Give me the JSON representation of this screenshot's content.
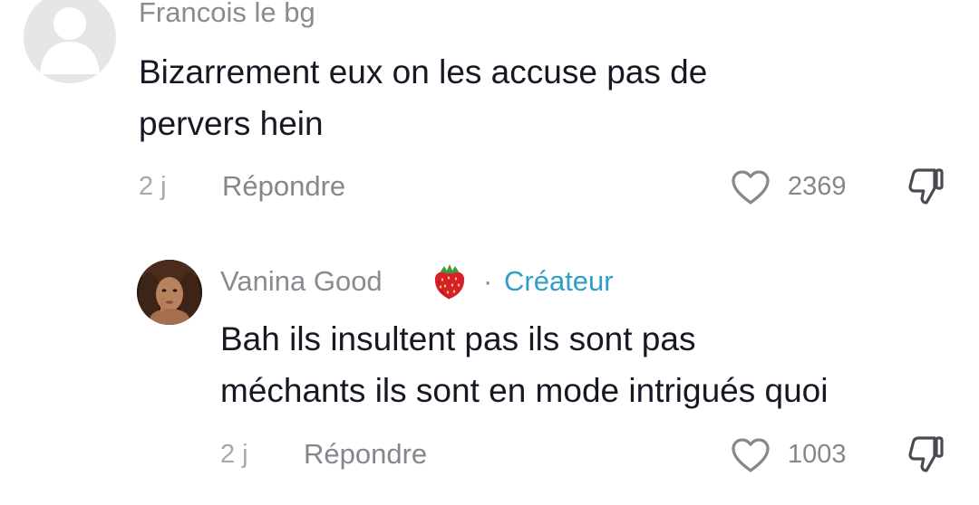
{
  "comments": [
    {
      "username": "Francois le bg",
      "text_line1": "Bizarrement eux on les accuse pas de",
      "text_line2": "pervers hein",
      "time": "2 j",
      "reply_label": "Répondre",
      "likes": "2369"
    },
    {
      "username": "Vanina Good",
      "username_emoji": "strawberry-icon",
      "badge_separator": "·",
      "badge": "Créateur",
      "text_line1": "Bah ils insultent pas ils sont pas",
      "text_line2": "méchants ils sont en mode intrigués quoi",
      "time": "2 j",
      "reply_label": "Répondre",
      "likes": "1003"
    }
  ],
  "colors": {
    "badge": "#2f9fc6",
    "secondary_text": "#86878d",
    "primary_text": "#161823"
  },
  "icons": {
    "like": "heart-outline-icon",
    "dislike": "thumbs-down-icon",
    "default_avatar": "person-silhouette-icon"
  }
}
